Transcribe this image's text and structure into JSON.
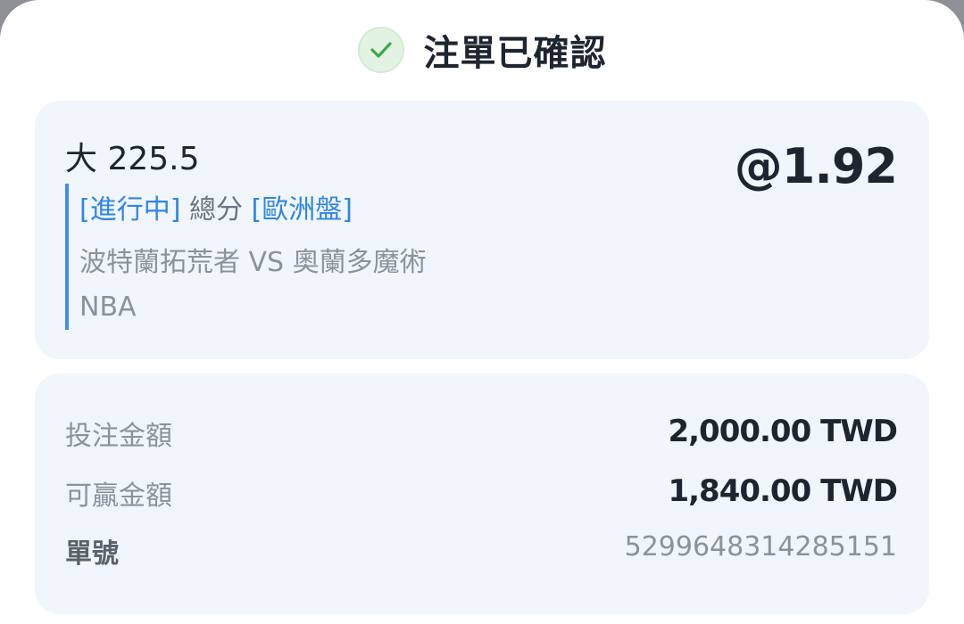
{
  "header": {
    "title": "注單已確認",
    "icon": "check-icon",
    "icon_color": "#3aa84a"
  },
  "bet": {
    "selection": "大 225.5",
    "odds": "@1.92",
    "status_tag": "[進行中]",
    "market": "總分",
    "odds_format_tag": "[歐洲盤]",
    "match": "波特蘭拓荒者 VS 奧蘭多魔術",
    "league": "NBA",
    "accent_color": "#3c8ff0"
  },
  "summary": {
    "stake_label": "投注金額",
    "stake_value": "2,000.00 TWD",
    "payout_label": "可贏金額",
    "payout_value": "1,840.00 TWD",
    "ticket_label": "單號",
    "ticket_value": "5299648314285151"
  }
}
